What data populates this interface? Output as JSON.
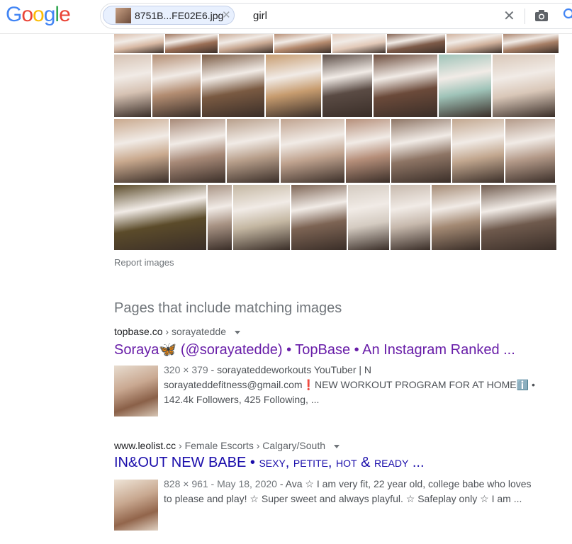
{
  "header": {
    "logo_letters": [
      {
        "ch": "G",
        "color": "#4285F4"
      },
      {
        "ch": "o",
        "color": "#EA4335"
      },
      {
        "ch": "o",
        "color": "#FBBC05"
      },
      {
        "ch": "g",
        "color": "#4285F4"
      },
      {
        "ch": "l",
        "color": "#34A853"
      },
      {
        "ch": "e",
        "color": "#EA4335"
      }
    ],
    "image_chip_name": "8751B...FE02E6.jpg",
    "query": "girl",
    "clear_glyph": "✕",
    "chip_remove_glyph": "✕"
  },
  "thumbnail_rows": [
    {
      "colors": [
        "#d8b9a4",
        "#9a6e55",
        "#c8a892",
        "#b58a6e",
        "#e2c9b8",
        "#7d5a48",
        "#cfb09b",
        "#a77f66"
      ]
    },
    {
      "colors": [
        "#d6c2b3",
        "#b38d72",
        "#7a5a42",
        "#c79c6f",
        "#5a4b44",
        "#6b4a3a",
        "#9fc3b8",
        "#d9c7b8"
      ]
    },
    {
      "colors": [
        "#c9a98e",
        "#a88a78",
        "#b89f8b",
        "#c0a38f",
        "#b68f7a",
        "#8e7565",
        "#c2a78f",
        "#b49a89"
      ]
    },
    {
      "colors": [
        "#5b4b2a",
        "#a99485",
        "#c4b7a2",
        "#7d6454",
        "#d4cbc1",
        "#c7b9ad",
        "#a48a74",
        "#6f5a4d"
      ]
    }
  ],
  "report_images": "Report images",
  "section_title": "Pages that include matching images",
  "results": [
    {
      "site": "topbase.co",
      "path": "sorayatedde",
      "title": "Soraya🦋 (@sorayatedde) • TopBase • An Instagram Ranked ...",
      "meta": "320 × 379",
      "snippet_line1": " - sorayateddeworkouts YouTuber | N",
      "snippet_line2": "sorayateddefitness@gmail.com❗NEW WORKOUT PROGRAM FOR AT HOMEℹ️ •",
      "snippet_line3": "142.4k Followers, 425 Following, ..."
    },
    {
      "site": "www.leolist.cc",
      "path": "Female Escorts › Calgary/South",
      "title_main": "IN&OUT NEW BABE • ",
      "title_sc": "sexy, petite, hot & ready ...",
      "meta": "828 × 961 - May 18, 2020",
      "snippet_line1": " - Ava ☆ I am very fit, 22 year old, college babe who loves",
      "snippet_line2": "to please and play! ☆ Super sweet and always playful. ☆ Safeplay only ☆ I am ..."
    }
  ]
}
